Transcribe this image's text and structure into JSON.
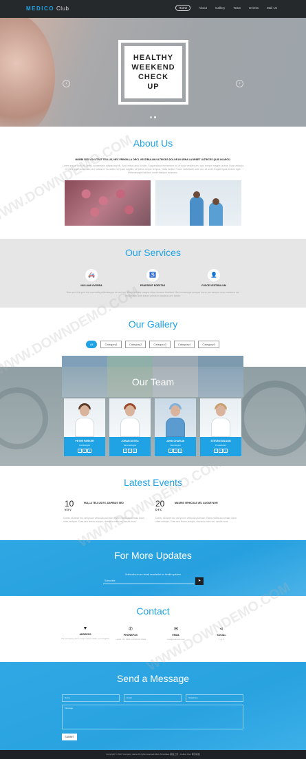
{
  "nav": {
    "logo": "MEDICO",
    "logo_suffix": "Club",
    "links": [
      "Home",
      "About",
      "Gallery",
      "Team",
      "Events",
      "Mail Us"
    ]
  },
  "hero": {
    "line1": "HEALTHY",
    "line2": "WEEKEND",
    "line3": "CHECK",
    "line4": "UP",
    "prev": "‹",
    "next": "›"
  },
  "about": {
    "title": "About Us",
    "lead": "MORBI SED VOLUTPAT TELLUS, NEC FRINGILLA ORCI. VESTIBULUM ULTRICES DOLOR IN URNA LAOREET ULTRICES QUIS IN ARCU.",
    "body": "Lorem ipsum dolor sit amet, consectetur adipiscing elit. Sed finibus arcu id nibh. Suspendisse fermentum mi ut tortor vestibulum, quis tempor magna lacinia. Duis vehicula mi nibh, eget accumsan orci luctus et. Curabitur vel justo sagittis, ut finibus neque tempus. Nulla facilisi. Fusce sollicitudin ante dui, sit amet feugiat ligula dictum eget. Pellentesque habitant morbi tristique senectus."
  },
  "services": {
    "title": "Our Services",
    "items": [
      {
        "icon": "ambulance-icon",
        "glyph": "🚑",
        "name": "NULLAM VIVERRA"
      },
      {
        "icon": "wheelchair-icon",
        "glyph": "♿",
        "name": "PRAESENT EGESTAS"
      },
      {
        "icon": "doctor-icon",
        "glyph": "👤",
        "name": "FUSCE VESTIBULUM"
      }
    ],
    "body": "Nam sed dui quis dui venenatis pellentesque ut sed nisi. Morbi efficitur magna vitae rhoncus tincidunt. Sed consequat semper lorem, eu semper eros maximus vel. Vestibulum ante ipsum primis in faucibus orci luctus."
  },
  "gallery": {
    "title": "Our Gallery",
    "filters": [
      "All",
      "Category1",
      "Category2",
      "Category3",
      "Category4",
      "Category5"
    ]
  },
  "team": {
    "title": "Our Team",
    "members": [
      {
        "name": "PETER PARKER",
        "role": "Cardiologist"
      },
      {
        "name": "JOHAN DOTEA",
        "role": "Dermatologist"
      },
      {
        "name": "JOHN CHARLIE",
        "role": "Neurologist"
      },
      {
        "name": "STEVEN WILSON",
        "role": "Pediatrician"
      }
    ],
    "social": [
      "f",
      "t",
      "g"
    ]
  },
  "events": {
    "title": "Latest Events",
    "items": [
      {
        "day": "10",
        "month": "NOV",
        "title": "NULLA TELLUS EX, DAPIBUS SED",
        "body": "Donec sit amet leo vel ipsum vehicula pulvinar. Etiam mollis accumsan dolor vitae semper. Cras sed lectus tempor, rhoncus enim vel, iaculis eros."
      },
      {
        "day": "20",
        "month": "DEC",
        "title": "MAURIS VEHICULA VEL AUGUE NON",
        "body": "Donec sit amet leo vel ipsum vehicula pulvinar. Etiam mollis accumsan dolor vitae semper. Cras sed lectus tempor, rhoncus enim vel, iaculis eros."
      }
    ]
  },
  "updates": {
    "title": "For More Updates",
    "label": "Subscribe to our email newsletter for health updates",
    "placeholder": "Subscribe",
    "button": "➤"
  },
  "contact": {
    "title": "Contact",
    "items": [
      {
        "icon": "map-marker-icon",
        "glyph": "▼",
        "name": "ADDRESS",
        "value": "The company name Lorem ipsum dolor, Los Angeles"
      },
      {
        "icon": "phone-icon",
        "glyph": "✆",
        "name": "PHONE/FAX",
        "value": "+1234 567 8901 +1234 567 8902"
      },
      {
        "icon": "envelope-icon",
        "glyph": "✉",
        "name": "EMAIL",
        "value": "mail@example.com"
      },
      {
        "icon": "share-icon",
        "glyph": "⋖",
        "name": "SOCIAL",
        "value": "f  t  g  in"
      }
    ]
  },
  "message": {
    "title": "Send a Message",
    "name_placeholder": "Name",
    "email_placeholder": "Email",
    "phone_placeholder": "Telephone",
    "message_placeholder": "Message",
    "send": "SUBMIT"
  },
  "footer": {
    "text": "Copyright © 2017 Company name All rights reserved.More Templates 模板之家 - Collect from 网页模板"
  },
  "watermark": "WWW.DOWNDEMO.COM",
  "colors": {
    "accent": "#1fa3e5",
    "nav": "#26292c",
    "footer": "#1e2226"
  }
}
